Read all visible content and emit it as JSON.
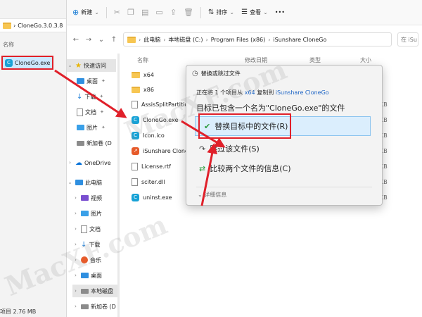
{
  "left_window": {
    "address": "CloneGo.3.0.3.8",
    "column_name": "名称",
    "selected_file": "CloneGo.exe",
    "status": "项目 2.76 MB"
  },
  "toolbar": {
    "new_label": "新建",
    "sort_label": "排序",
    "view_label": "查看",
    "more_label": "•••"
  },
  "address": {
    "segments": [
      "此电脑",
      "本地磁盘 (C:)",
      "Program Files (x86)",
      "iSunshare CloneGo"
    ],
    "search_placeholder": "在 iSu"
  },
  "nav_pane": {
    "items": [
      {
        "label": "快速访问"
      },
      {
        "label": "桌面"
      },
      {
        "label": "下载"
      },
      {
        "label": "文档"
      },
      {
        "label": "图片"
      },
      {
        "label": "新加卷 (D"
      },
      {
        "label": "OneDrive"
      },
      {
        "label": "此电脑"
      },
      {
        "label": "视频"
      },
      {
        "label": "图片"
      },
      {
        "label": "文档"
      },
      {
        "label": "下载"
      },
      {
        "label": "音乐"
      },
      {
        "label": "桌面"
      },
      {
        "label": "本地磁盘"
      },
      {
        "label": "新加卷 (D"
      }
    ]
  },
  "file_list": {
    "headers": {
      "name": "名称",
      "modified": "修改日期",
      "type": "类型",
      "size": "大小"
    },
    "rows": [
      {
        "name": "x64",
        "size": ""
      },
      {
        "name": "x86",
        "size": ""
      },
      {
        "name": "AssisSplitPartition",
        "size": "KB"
      },
      {
        "name": "CloneGo.exe",
        "size": "KB"
      },
      {
        "name": "Icon.ico",
        "size": "KB"
      },
      {
        "name": "iSunshare CloneGo",
        "size": "KB"
      },
      {
        "name": "License.rtf",
        "size": "KB"
      },
      {
        "name": "sciter.dll",
        "size": "KB"
      },
      {
        "name": "uninst.exe",
        "size": "KB"
      }
    ]
  },
  "dialog": {
    "title": "替换或跳过文件",
    "subtitle_prefix": "正在将 1 个项目从",
    "subtitle_src": "x64",
    "subtitle_mid": "复制到",
    "subtitle_dst": "iSunshare CloneGo",
    "heading": "目标已包含一个名为\"CloneGo.exe\"的文件",
    "option_replace": "替换目标中的文件(R)",
    "option_skip": "跳过该文件(S)",
    "option_compare": "比较两个文件的信息(C)",
    "more_details": "详细信息"
  },
  "watermark": "MacXF.com"
}
